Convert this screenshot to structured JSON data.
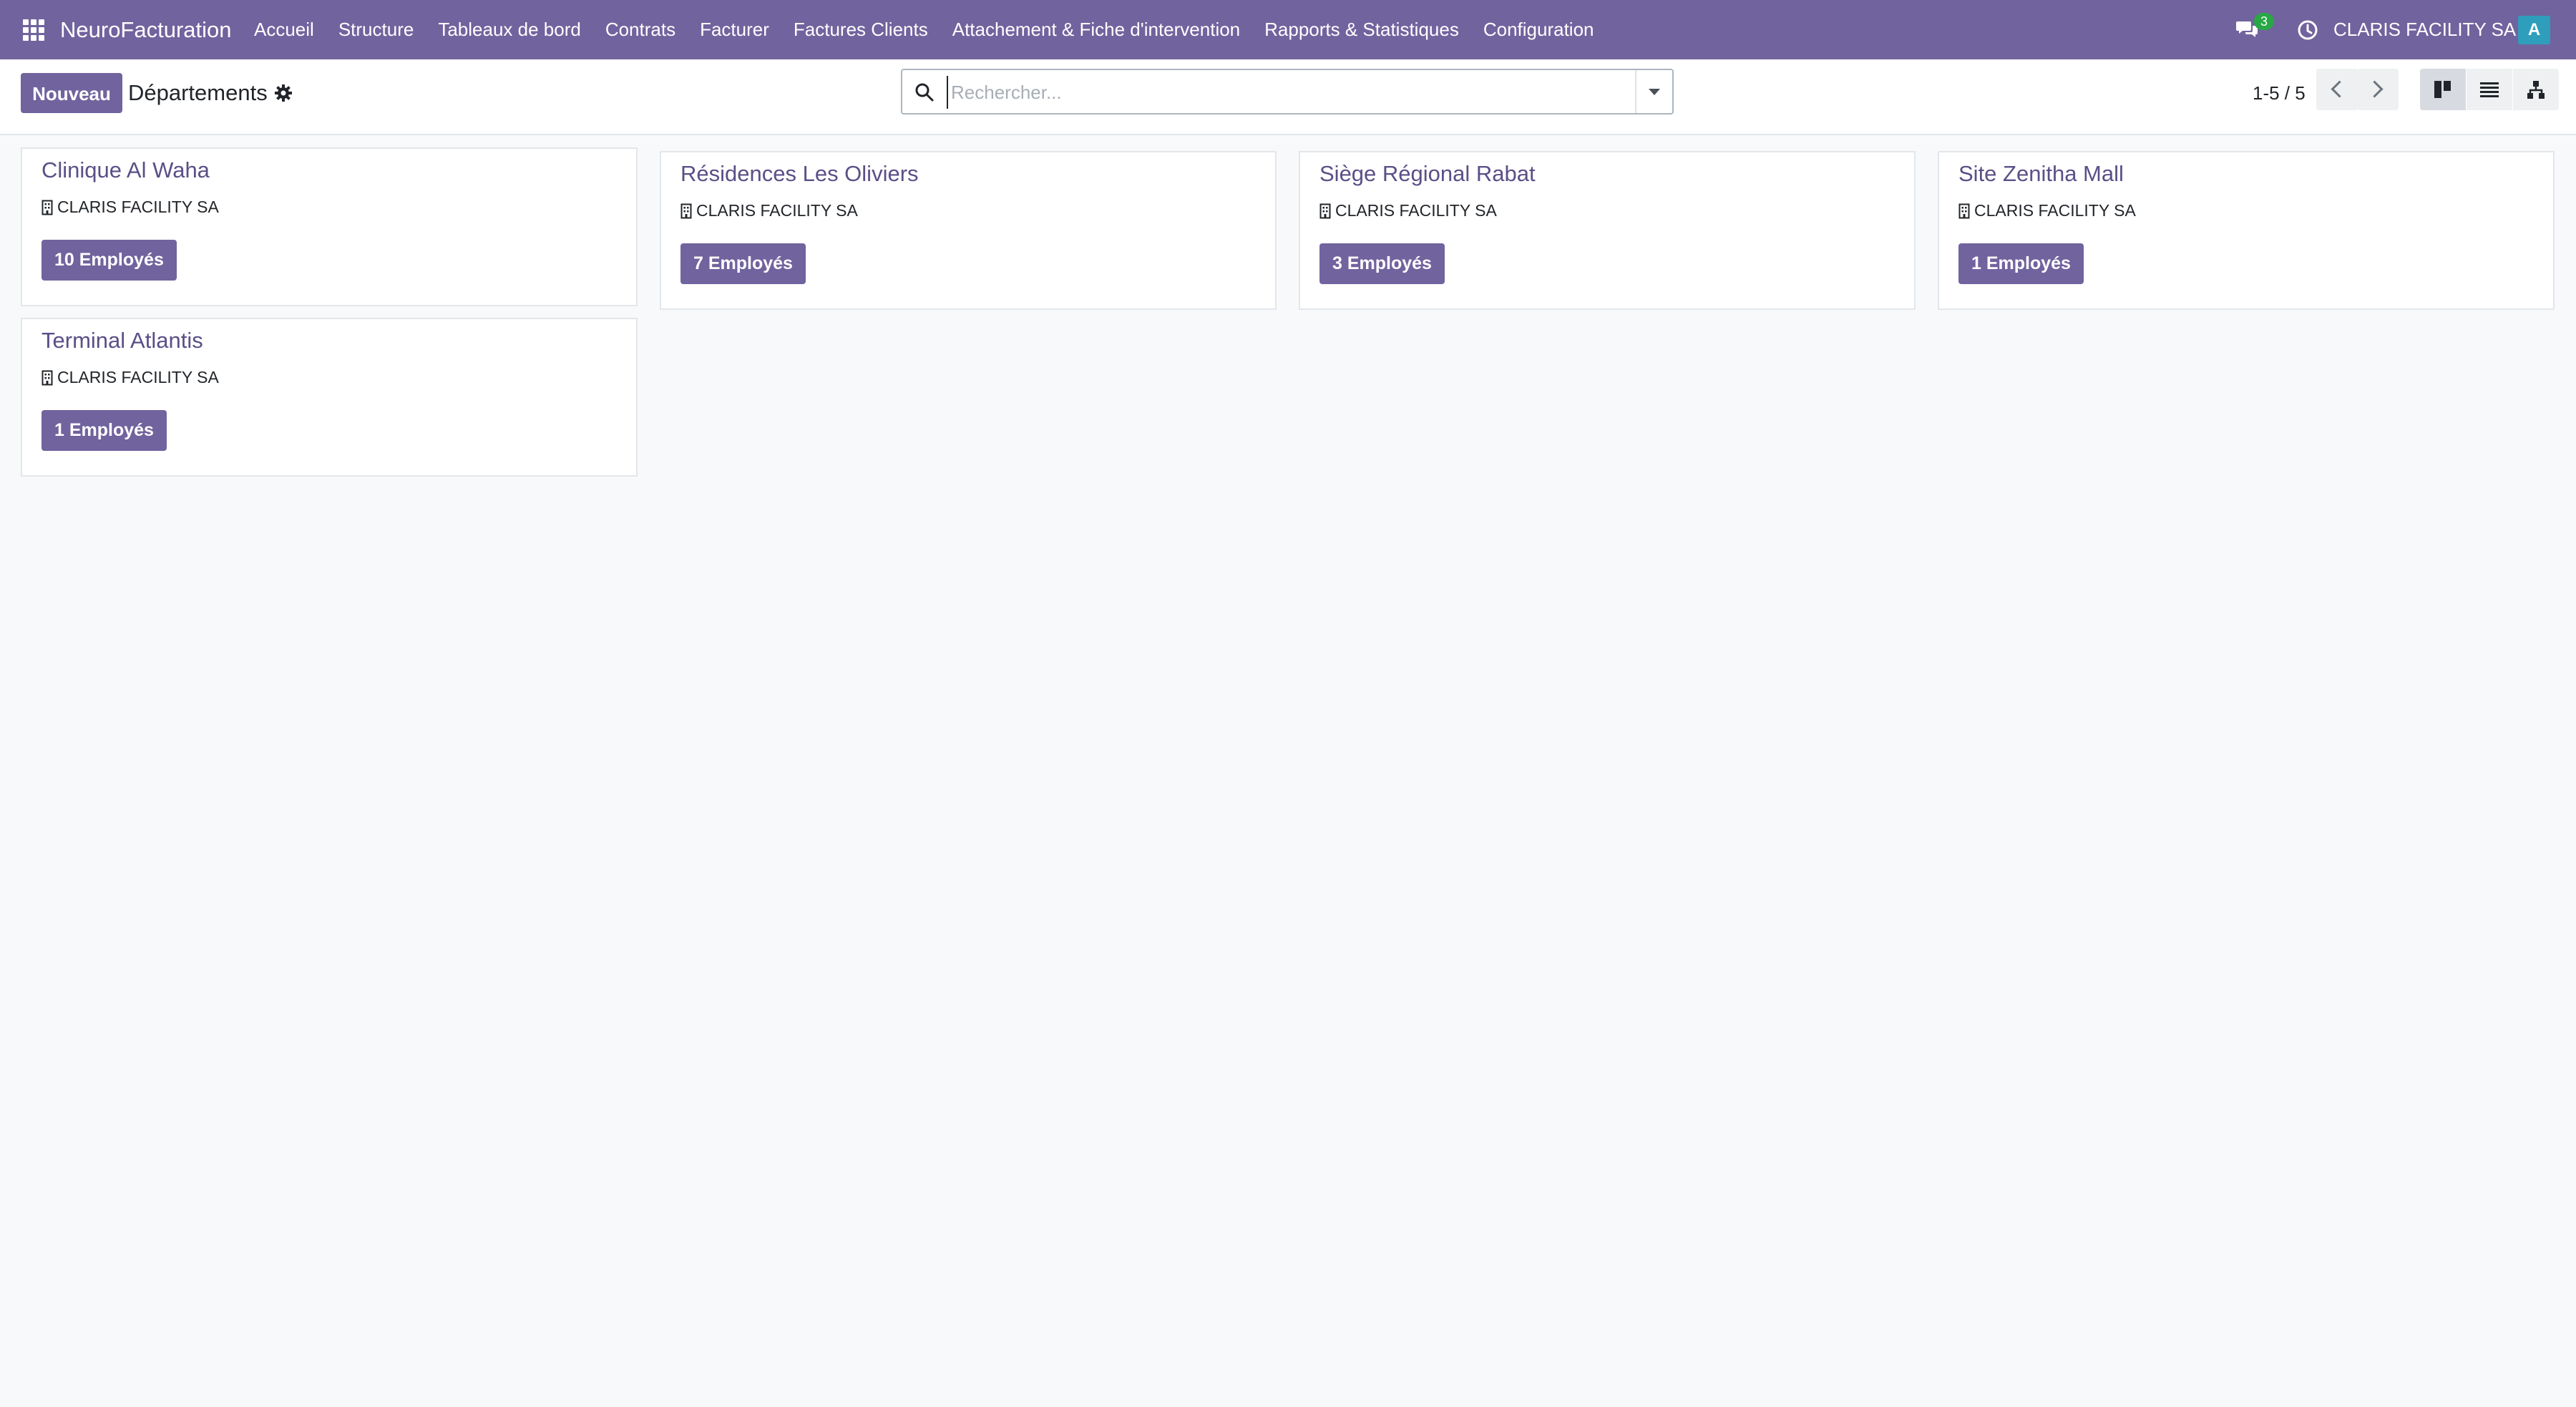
{
  "app": {
    "name": "NeuroFacturation"
  },
  "menu": [
    "Accueil",
    "Structure",
    "Tableaux de bord",
    "Contrats",
    "Facturer",
    "Factures Clients",
    "Attachement & Fiche d'intervention",
    "Rapports & Statistiques",
    "Configuration"
  ],
  "topbar": {
    "chat_count": "3",
    "company": "CLARIS FACILITY SA",
    "avatar_letter": "A"
  },
  "control": {
    "new_label": "Nouveau",
    "breadcrumb": "Départements",
    "search_placeholder": "Rechercher...",
    "pager": "1-5 / 5"
  },
  "cards": [
    {
      "title": "Clinique Al Waha",
      "company": "CLARIS FACILITY SA",
      "employees": "10 Employés"
    },
    {
      "title": "Résidences Les Oliviers",
      "company": "CLARIS FACILITY SA",
      "employees": "7 Employés"
    },
    {
      "title": "Siège Régional Rabat",
      "company": "CLARIS FACILITY SA",
      "employees": "3 Employés"
    },
    {
      "title": "Site Zenitha Mall",
      "company": "CLARIS FACILITY SA",
      "employees": "1 Employés"
    },
    {
      "title": "Terminal Atlantis",
      "company": "CLARIS FACILITY SA",
      "employees": "1 Employés"
    }
  ],
  "colors": {
    "brand": "#71639e",
    "badge": "#28a745",
    "avatar": "#2e9ebc",
    "title": "#5b4f87"
  }
}
